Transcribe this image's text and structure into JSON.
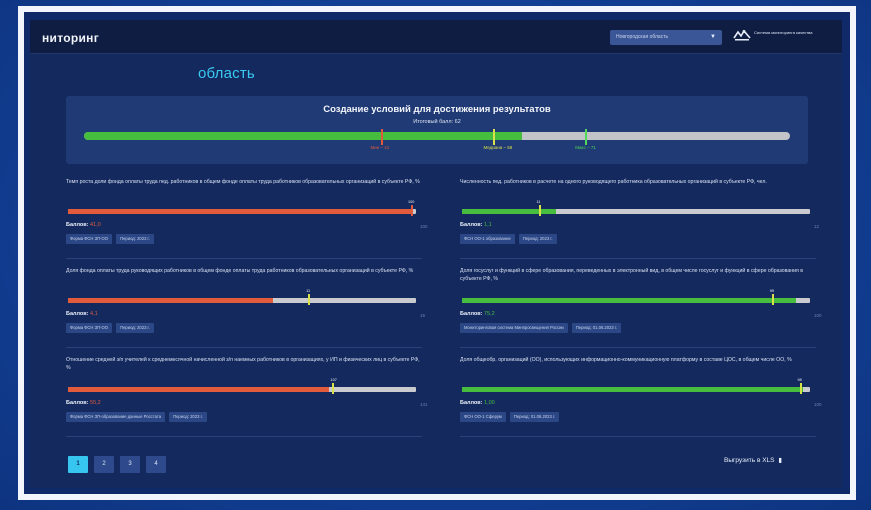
{
  "app": {
    "title": "ниторинг",
    "region_select": "Новгородская область",
    "region_select_icon": "chevron-down-icon",
    "brand_text": "Система мониторинга качества",
    "region_heading": "область"
  },
  "summary": {
    "title": "Создание условий для достижения результатов",
    "score_text": "Итоговый балл: 62",
    "fill_fraction": 0.62,
    "fill_color": "#46bd3e",
    "markers": [
      {
        "label": "Мин – 41",
        "color": "#e05a3a",
        "fraction": 0.42
      },
      {
        "label": "Медиана – 58",
        "color": "#d8e04a",
        "fraction": 0.58
      },
      {
        "label": "Макс – 71",
        "color": "#4fd95a",
        "fraction": 0.71
      }
    ]
  },
  "metrics": [
    {
      "text": "Темп роста доли фонда оплаты труда пед. работников в общем фонде оплаты труда работников образовательных организаций в субъекте РФ, %",
      "score_label": "Баллов:",
      "score": "41,0",
      "score_color": "#e25b3c",
      "fraction": 0.99,
      "value_label": "100",
      "max_label": "100",
      "bar_color": "#e25b3c",
      "marker_fraction": 0.985,
      "marker_color": "#e25b3c",
      "tags": [
        "Форма ФСН ЗП-ОО",
        "Период: 2023 г."
      ]
    },
    {
      "text": "Численность пед. работников в расчете на одного руководящего работника образовательных организаций в субъекте РФ, чел.",
      "score_label": "Баллов:",
      "score": "1,1",
      "score_color": "#46bd3e",
      "fraction": 0.27,
      "value_label": "11",
      "max_label": "12",
      "bar_color": "#46bd3e",
      "marker_fraction": 0.22,
      "marker_color": "#d8e04a",
      "tags": [
        "ФСН ОО-1 образование",
        "Период: 2023 г."
      ]
    },
    {
      "text": "Доля фонда оплаты труда руководящих работников в общем фонде оплаты труда работников образовательных организаций в субъекте РФ, %",
      "score_label": "Баллов:",
      "score": "4,1",
      "score_color": "#e25b3c",
      "fraction": 0.59,
      "value_label": "11",
      "max_label": "15",
      "bar_color": "#e25b3c",
      "marker_fraction": 0.69,
      "marker_color": "#d8e04a",
      "tags": [
        "Форма ФСН ЗП-ОО",
        "Период: 2023 г."
      ]
    },
    {
      "text": "Доля госуслуг и функций в сфере образования, переведенных в электронный вид, в общем числе госуслуг и функций в сфере образования в субъекте РФ, %",
      "score_label": "Баллов:",
      "score": "75,2",
      "score_color": "#46bd3e",
      "fraction": 0.96,
      "value_label": "99",
      "max_label": "100",
      "bar_color": "#46bd3e",
      "marker_fraction": 0.89,
      "marker_color": "#d8e04a",
      "tags": [
        "Мониторинговая система Минпросвещения России",
        "Период: 01.06.2023 г."
      ]
    },
    {
      "text": "Отношение средней з/п учителей к среднемесячной начисленной з/п наемных работников в организациях, у ИП и физических лиц в субъекте РФ, %",
      "score_label": "Баллов:",
      "score": "55,2",
      "score_color": "#e25b3c",
      "fraction": 0.75,
      "value_label": "107",
      "max_label": "141",
      "bar_color": "#e25b3c",
      "marker_fraction": 0.76,
      "marker_color": "#d8e04a",
      "tags": [
        "Форма ФСН ЗП-образование данные Росстата",
        "Период: 2023 г."
      ]
    },
    {
      "text": "Доля общеобр. организаций (ОО), использующих информационно-коммуникационную платформу в составе ЦОС, в общем числе ОО, %",
      "score_label": "Баллов:",
      "score": "1,00",
      "score_color": "#46bd3e",
      "fraction": 0.98,
      "value_label": "98",
      "max_label": "100",
      "bar_color": "#46bd3e",
      "marker_fraction": 0.97,
      "marker_color": "#d8e04a",
      "tags": [
        "ФСН ОО-1 Сферум",
        "Период: 01.06.2023 г."
      ]
    }
  ],
  "pagination": {
    "pages": [
      "1",
      "2",
      "3",
      "4"
    ],
    "active": "1"
  },
  "export": {
    "label": "Выгрузить в XLS",
    "icon": "document-icon"
  }
}
